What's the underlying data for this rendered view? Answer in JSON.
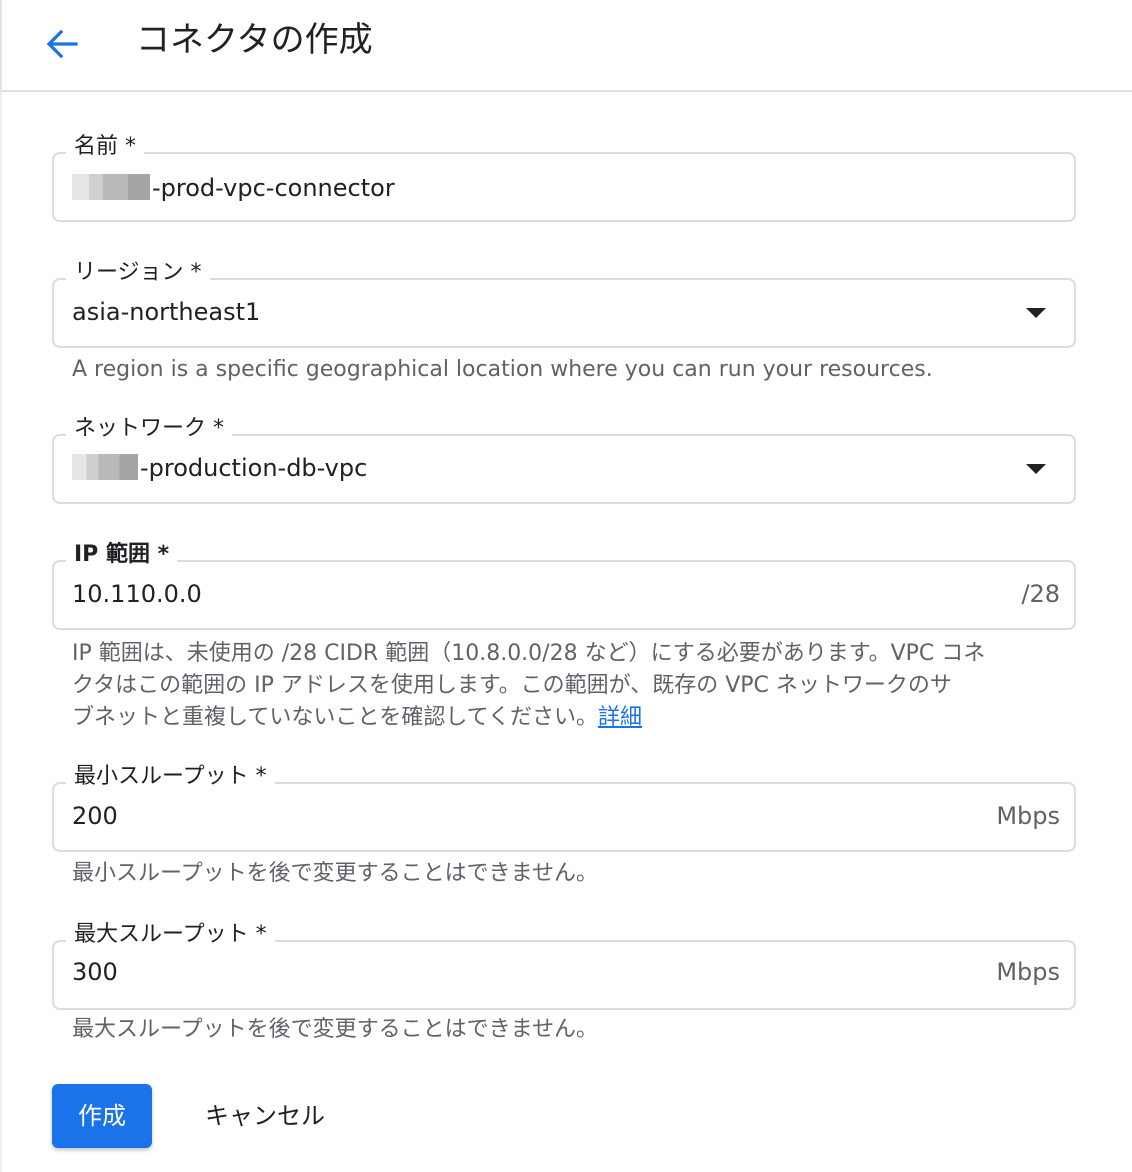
{
  "header": {
    "back_icon": "arrow-back-icon",
    "title": "コネクタの作成"
  },
  "colors": {
    "accent": "#1a73e8",
    "border": "#dadce0",
    "hint_text": "#5f6368"
  },
  "form": {
    "name": {
      "label": "名前 *",
      "value": "-prod-vpc-connector"
    },
    "region": {
      "label": "リージョン *",
      "value": "asia-northeast1",
      "hint": "A region is a specific geographical location where you can run your resources.",
      "dropdown_icon": "arrow-drop-down-icon"
    },
    "network": {
      "label": "ネットワーク *",
      "value": "-production-db-vpc",
      "dropdown_icon": "arrow-drop-down-icon"
    },
    "ip_range": {
      "label": "IP 範囲 *",
      "value": "10.110.0.0",
      "suffix": "/28",
      "hint_line1": "IP 範囲は、未使用の /28 CIDR 範囲（10.8.0.0/28 など）にする必要があります。VPC コネ",
      "hint_line2": "クタはこの範囲の IP アドレスを使用します。この範囲が、既存の VPC ネットワークのサ",
      "hint_line3": "ブネットと重複していないことを確認してください。",
      "hint_link": "詳細"
    },
    "min_throughput": {
      "label": "最小スループット *",
      "value": "200",
      "suffix": "Mbps",
      "hint": "最小スループットを後で変更することはできません。"
    },
    "max_throughput": {
      "label": "最大スループット *",
      "value": "300",
      "suffix": "Mbps",
      "hint": "最大スループットを後で変更することはできません。"
    }
  },
  "actions": {
    "create_label": "作成",
    "cancel_label": "キャンセル"
  }
}
